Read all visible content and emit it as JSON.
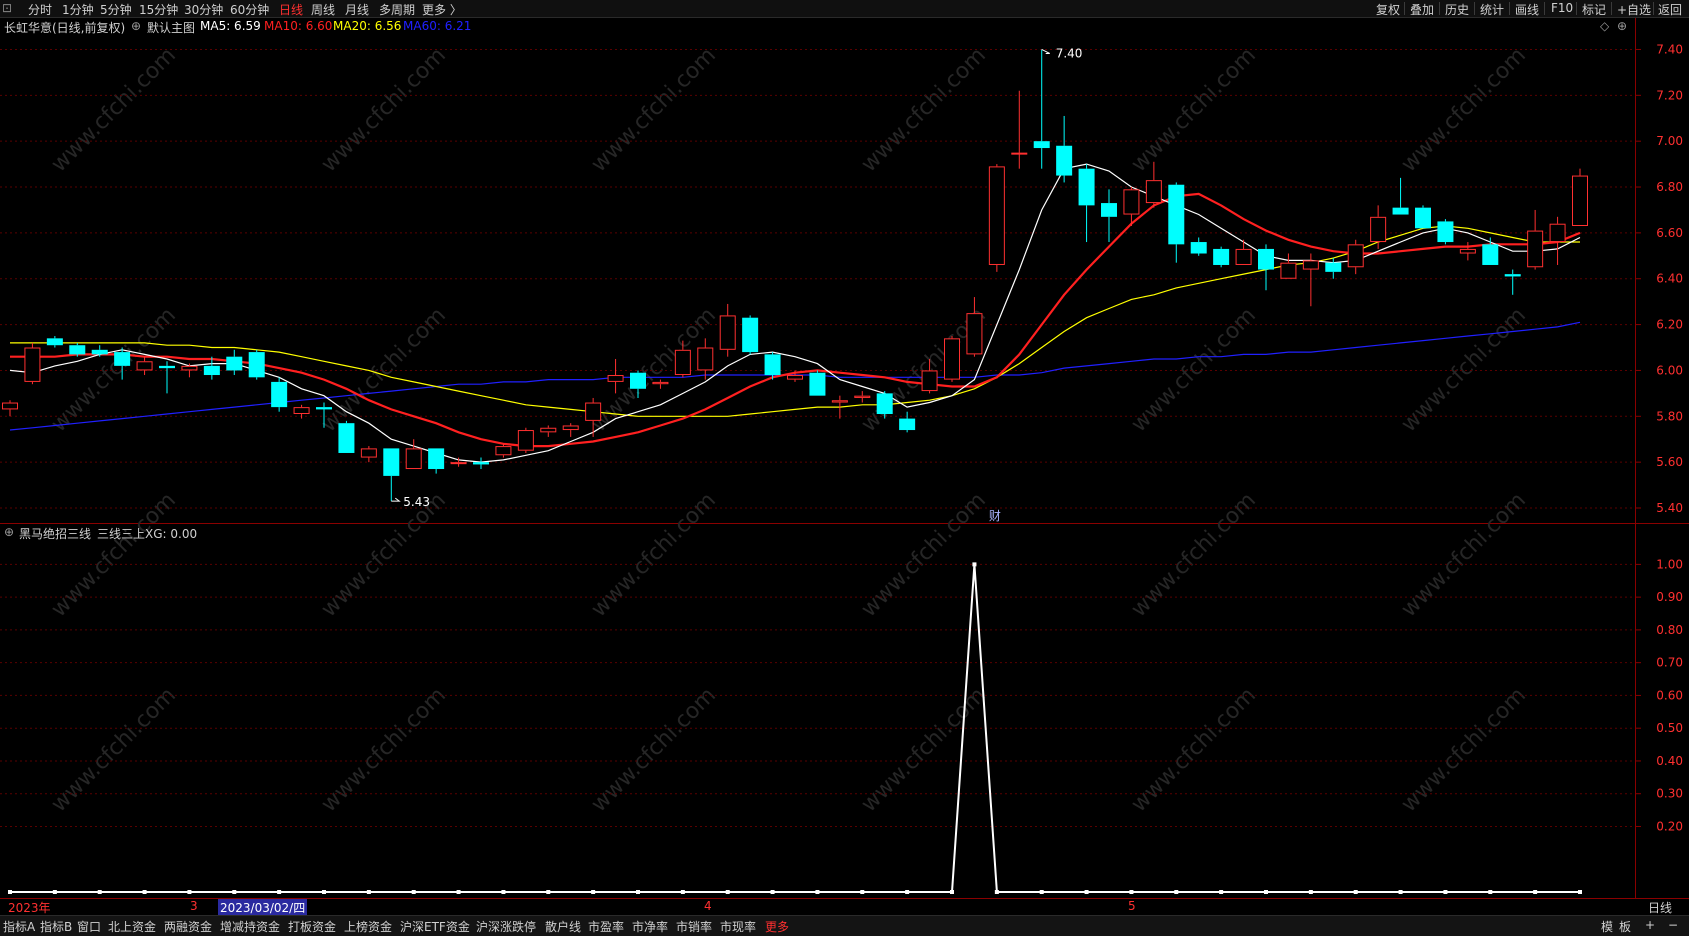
{
  "toolbar": {
    "logo": "⊡",
    "periods": [
      "分时",
      "1分钟",
      "5分钟",
      "15分钟",
      "30分钟",
      "60分钟",
      "日线",
      "周线",
      "月线",
      "多周期",
      "更多 〉"
    ],
    "active_period": "日线",
    "right_buttons": [
      "复权",
      "叠加",
      "历史",
      "统计",
      "画线",
      "F10",
      "标记",
      "+自选",
      "返回"
    ]
  },
  "main_panel": {
    "stock_title": "长虹华意(日线,前复权)",
    "indicator_name": "默认主图",
    "ma_items": [
      {
        "label": "MA5: 6.59",
        "color": "#ffffff"
      },
      {
        "label": "MA10: 6.60",
        "color": "#ff2020"
      },
      {
        "label": "MA20: 6.56",
        "color": "#ffff00"
      },
      {
        "label": "MA60: 6.21",
        "color": "#2020ff"
      }
    ],
    "diamond_icon": "◇",
    "settings_icon": "⊕",
    "y_ticks": [
      "7.40",
      "7.20",
      "7.00",
      "6.80",
      "6.60",
      "6.40",
      "6.20",
      "6.00",
      "5.80",
      "5.60",
      "5.40"
    ],
    "high_label": "7.40",
    "low_label": "5.43",
    "finance_marker": "财"
  },
  "sub_panel": {
    "title": "黑马绝招三线",
    "value_label": "三线三上XG: 0.00",
    "y_ticks": [
      "1.00",
      "0.90",
      "0.80",
      "0.70",
      "0.60",
      "0.50",
      "0.40",
      "0.30",
      "0.20"
    ]
  },
  "date_axis": {
    "labels": [
      "2023年",
      "3",
      "2023/03/02/四",
      "4",
      "5"
    ],
    "period_label": "日线"
  },
  "watermark": "www.cfchi.com",
  "bottom_tabs": [
    "指标A",
    "指标B",
    "窗口",
    "北上资金",
    "两融资金",
    "增减持资金",
    "打板资金",
    "上榜资金",
    "沪深ETF资金",
    "沪深涨跌停",
    "散户线",
    "市盈率",
    "市净率",
    "市销率",
    "市现率",
    "更多"
  ],
  "bottom_active": "更多",
  "bottom_right": [
    "模",
    "板",
    "+",
    "−"
  ],
  "colors": {
    "up": "#ff3030",
    "down": "#00ffff",
    "ma5": "#ffffff",
    "ma10": "#ff2020",
    "ma20": "#ffff00",
    "ma60": "#2020ff",
    "grid": "#5a0000"
  },
  "chart_data": {
    "type": "candlestick",
    "ylim": [
      5.4,
      7.45
    ],
    "candles": [
      {
        "o": 5.83,
        "h": 5.87,
        "l": 5.8,
        "c": 5.86
      },
      {
        "o": 5.95,
        "h": 6.12,
        "l": 5.94,
        "c": 6.1
      },
      {
        "o": 6.14,
        "h": 6.15,
        "l": 6.1,
        "c": 6.11
      },
      {
        "o": 6.11,
        "h": 6.12,
        "l": 6.06,
        "c": 6.07
      },
      {
        "o": 6.09,
        "h": 6.11,
        "l": 6.06,
        "c": 6.07
      },
      {
        "o": 6.08,
        "h": 6.1,
        "l": 5.96,
        "c": 6.02
      },
      {
        "o": 6.0,
        "h": 6.06,
        "l": 5.98,
        "c": 6.04
      },
      {
        "o": 6.02,
        "h": 6.04,
        "l": 5.9,
        "c": 6.01
      },
      {
        "o": 6.0,
        "h": 6.03,
        "l": 5.97,
        "c": 6.02
      },
      {
        "o": 6.02,
        "h": 6.06,
        "l": 5.96,
        "c": 5.98
      },
      {
        "o": 6.06,
        "h": 6.09,
        "l": 5.98,
        "c": 6.0
      },
      {
        "o": 6.08,
        "h": 6.09,
        "l": 5.96,
        "c": 5.97
      },
      {
        "o": 5.95,
        "h": 5.97,
        "l": 5.82,
        "c": 5.84
      },
      {
        "o": 5.81,
        "h": 5.85,
        "l": 5.79,
        "c": 5.84
      },
      {
        "o": 5.84,
        "h": 5.86,
        "l": 5.75,
        "c": 5.83
      },
      {
        "o": 5.77,
        "h": 5.78,
        "l": 5.64,
        "c": 5.64
      },
      {
        "o": 5.62,
        "h": 5.67,
        "l": 5.6,
        "c": 5.66
      },
      {
        "o": 5.66,
        "h": 5.66,
        "l": 5.43,
        "c": 5.54
      },
      {
        "o": 5.57,
        "h": 5.7,
        "l": 5.57,
        "c": 5.66
      },
      {
        "o": 5.66,
        "h": 5.66,
        "l": 5.55,
        "c": 5.57
      },
      {
        "o": 5.6,
        "h": 5.62,
        "l": 5.58,
        "c": 5.6
      },
      {
        "o": 5.6,
        "h": 5.62,
        "l": 5.57,
        "c": 5.59
      },
      {
        "o": 5.63,
        "h": 5.68,
        "l": 5.62,
        "c": 5.67
      },
      {
        "o": 5.65,
        "h": 5.75,
        "l": 5.64,
        "c": 5.74
      },
      {
        "o": 5.73,
        "h": 5.76,
        "l": 5.71,
        "c": 5.75
      },
      {
        "o": 5.74,
        "h": 5.77,
        "l": 5.71,
        "c": 5.76
      },
      {
        "o": 5.78,
        "h": 5.88,
        "l": 5.71,
        "c": 5.86
      },
      {
        "o": 5.95,
        "h": 6.05,
        "l": 5.9,
        "c": 5.98
      },
      {
        "o": 5.99,
        "h": 6.0,
        "l": 5.88,
        "c": 5.92
      },
      {
        "o": 5.94,
        "h": 5.96,
        "l": 5.92,
        "c": 5.95
      },
      {
        "o": 5.98,
        "h": 6.13,
        "l": 5.97,
        "c": 6.09
      },
      {
        "o": 6.0,
        "h": 6.14,
        "l": 5.96,
        "c": 6.1
      },
      {
        "o": 6.09,
        "h": 6.29,
        "l": 6.06,
        "c": 6.24
      },
      {
        "o": 6.23,
        "h": 6.24,
        "l": 6.07,
        "c": 6.08
      },
      {
        "o": 6.07,
        "h": 6.08,
        "l": 5.96,
        "c": 5.98
      },
      {
        "o": 5.96,
        "h": 6.0,
        "l": 5.95,
        "c": 5.98
      },
      {
        "o": 5.99,
        "h": 6.0,
        "l": 5.89,
        "c": 5.89
      },
      {
        "o": 5.86,
        "h": 5.89,
        "l": 5.79,
        "c": 5.87
      },
      {
        "o": 5.88,
        "h": 5.91,
        "l": 5.86,
        "c": 5.89
      },
      {
        "o": 5.9,
        "h": 5.91,
        "l": 5.79,
        "c": 5.81
      },
      {
        "o": 5.79,
        "h": 5.82,
        "l": 5.73,
        "c": 5.74
      },
      {
        "o": 5.91,
        "h": 6.05,
        "l": 5.9,
        "c": 6.0
      },
      {
        "o": 5.96,
        "h": 6.15,
        "l": 5.95,
        "c": 6.14
      },
      {
        "o": 6.07,
        "h": 6.32,
        "l": 6.06,
        "c": 6.25
      },
      {
        "o": 6.46,
        "h": 6.9,
        "l": 6.43,
        "c": 6.89
      },
      {
        "o": 6.95,
        "h": 7.22,
        "l": 6.88,
        "c": 6.95
      },
      {
        "o": 7.0,
        "h": 7.4,
        "l": 6.88,
        "c": 6.97
      },
      {
        "o": 6.98,
        "h": 7.11,
        "l": 6.82,
        "c": 6.85
      },
      {
        "o": 6.88,
        "h": 6.9,
        "l": 6.56,
        "c": 6.72
      },
      {
        "o": 6.73,
        "h": 6.79,
        "l": 6.56,
        "c": 6.67
      },
      {
        "o": 6.68,
        "h": 6.8,
        "l": 6.63,
        "c": 6.79
      },
      {
        "o": 6.73,
        "h": 6.91,
        "l": 6.71,
        "c": 6.83
      },
      {
        "o": 6.81,
        "h": 6.82,
        "l": 6.47,
        "c": 6.55
      },
      {
        "o": 6.56,
        "h": 6.58,
        "l": 6.5,
        "c": 6.51
      },
      {
        "o": 6.53,
        "h": 6.54,
        "l": 6.45,
        "c": 6.46
      },
      {
        "o": 6.46,
        "h": 6.57,
        "l": 6.46,
        "c": 6.53
      },
      {
        "o": 6.53,
        "h": 6.55,
        "l": 6.35,
        "c": 6.44
      },
      {
        "o": 6.4,
        "h": 6.51,
        "l": 6.4,
        "c": 6.47
      },
      {
        "o": 6.44,
        "h": 6.51,
        "l": 6.28,
        "c": 6.48
      },
      {
        "o": 6.47,
        "h": 6.49,
        "l": 6.4,
        "c": 6.43
      },
      {
        "o": 6.45,
        "h": 6.57,
        "l": 6.42,
        "c": 6.55
      },
      {
        "o": 6.56,
        "h": 6.72,
        "l": 6.53,
        "c": 6.67
      },
      {
        "o": 6.71,
        "h": 6.84,
        "l": 6.68,
        "c": 6.68
      },
      {
        "o": 6.71,
        "h": 6.72,
        "l": 6.62,
        "c": 6.62
      },
      {
        "o": 6.65,
        "h": 6.66,
        "l": 6.55,
        "c": 6.56
      },
      {
        "o": 6.51,
        "h": 6.56,
        "l": 6.48,
        "c": 6.53
      },
      {
        "o": 6.55,
        "h": 6.58,
        "l": 6.46,
        "c": 6.46
      },
      {
        "o": 6.42,
        "h": 6.44,
        "l": 6.33,
        "c": 6.41
      },
      {
        "o": 6.45,
        "h": 6.7,
        "l": 6.44,
        "c": 6.61
      },
      {
        "o": 6.56,
        "h": 6.67,
        "l": 6.46,
        "c": 6.64
      },
      {
        "o": 6.63,
        "h": 6.88,
        "l": 6.63,
        "c": 6.85
      }
    ],
    "ma5": [
      6.0,
      5.99,
      6.02,
      6.04,
      6.07,
      6.09,
      6.07,
      6.05,
      6.02,
      6.03,
      6.03,
      6.0,
      5.97,
      5.92,
      5.89,
      5.82,
      5.77,
      5.7,
      5.67,
      5.64,
      5.61,
      5.6,
      5.61,
      5.63,
      5.65,
      5.69,
      5.73,
      5.79,
      5.82,
      5.85,
      5.9,
      5.95,
      6.02,
      6.07,
      6.08,
      6.06,
      6.03,
      5.96,
      5.93,
      5.9,
      5.84,
      5.86,
      5.89,
      5.96,
      6.2,
      6.44,
      6.7,
      6.88,
      6.9,
      6.87,
      6.8,
      6.76,
      6.72,
      6.68,
      6.62,
      6.56,
      6.5,
      6.48,
      6.48,
      6.47,
      6.48,
      6.52,
      6.56,
      6.6,
      6.62,
      6.6,
      6.56,
      6.52,
      6.52,
      6.53,
      6.58
    ],
    "ma10": [
      6.06,
      6.06,
      6.06,
      6.07,
      6.07,
      6.07,
      6.06,
      6.06,
      6.05,
      6.05,
      6.04,
      6.03,
      6.01,
      5.99,
      5.96,
      5.92,
      5.87,
      5.83,
      5.8,
      5.77,
      5.73,
      5.7,
      5.68,
      5.67,
      5.67,
      5.68,
      5.69,
      5.71,
      5.73,
      5.76,
      5.79,
      5.83,
      5.88,
      5.93,
      5.97,
      5.99,
      6.0,
      5.99,
      5.98,
      5.97,
      5.95,
      5.94,
      5.93,
      5.93,
      5.97,
      6.07,
      6.2,
      6.33,
      6.44,
      6.54,
      6.64,
      6.72,
      6.76,
      6.77,
      6.72,
      6.66,
      6.61,
      6.57,
      6.54,
      6.52,
      6.51,
      6.51,
      6.52,
      6.53,
      6.54,
      6.54,
      6.55,
      6.55,
      6.55,
      6.56,
      6.6
    ],
    "ma20": [
      6.12,
      6.12,
      6.12,
      6.12,
      6.12,
      6.12,
      6.12,
      6.11,
      6.11,
      6.1,
      6.1,
      6.09,
      6.08,
      6.06,
      6.04,
      6.02,
      6.0,
      5.97,
      5.95,
      5.93,
      5.91,
      5.89,
      5.87,
      5.85,
      5.84,
      5.83,
      5.82,
      5.81,
      5.8,
      5.8,
      5.8,
      5.8,
      5.8,
      5.81,
      5.82,
      5.83,
      5.84,
      5.84,
      5.85,
      5.85,
      5.86,
      5.87,
      5.89,
      5.92,
      5.97,
      6.03,
      6.1,
      6.17,
      6.23,
      6.27,
      6.31,
      6.33,
      6.36,
      6.38,
      6.4,
      6.42,
      6.44,
      6.46,
      6.47,
      6.49,
      6.52,
      6.56,
      6.59,
      6.62,
      6.63,
      6.62,
      6.6,
      6.58,
      6.56,
      6.56,
      6.56
    ],
    "ma60": [
      5.74,
      5.75,
      5.76,
      5.77,
      5.78,
      5.79,
      5.8,
      5.81,
      5.82,
      5.83,
      5.84,
      5.85,
      5.86,
      5.87,
      5.88,
      5.89,
      5.9,
      5.91,
      5.92,
      5.93,
      5.94,
      5.94,
      5.95,
      5.95,
      5.96,
      5.96,
      5.96,
      5.97,
      5.97,
      5.97,
      5.97,
      5.98,
      5.98,
      5.98,
      5.98,
      5.98,
      5.98,
      5.97,
      5.97,
      5.97,
      5.97,
      5.97,
      5.97,
      5.97,
      5.98,
      5.98,
      5.99,
      6.01,
      6.02,
      6.03,
      6.04,
      6.05,
      6.05,
      6.06,
      6.06,
      6.07,
      6.07,
      6.08,
      6.08,
      6.09,
      6.1,
      6.11,
      6.12,
      6.13,
      6.14,
      6.15,
      6.16,
      6.17,
      6.18,
      6.19,
      6.21
    ],
    "signal_series": {
      "name": "三线三上XG",
      "ylim": [
        0,
        1.05
      ],
      "peak_index": 43,
      "peak_value": 1.0,
      "base_value": 0.0
    }
  }
}
